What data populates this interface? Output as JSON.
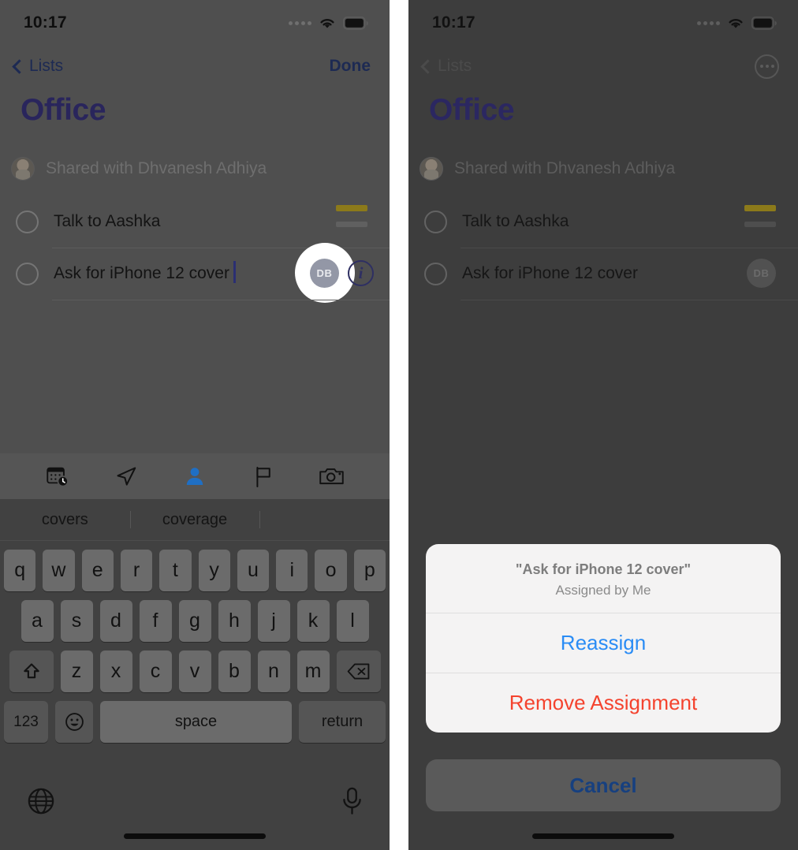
{
  "status_bar": {
    "time": "10:17",
    "signal_icon": "signal-dots-icon",
    "wifi_icon": "wifi-icon",
    "battery_icon": "battery-icon"
  },
  "left_panel": {
    "nav": {
      "back_label": "Lists",
      "back_icon": "chevron-left-icon",
      "done_label": "Done"
    },
    "list_title": "Office",
    "shared_label": "Shared with Dhvanesh Adhiya",
    "reminders": [
      {
        "text": "Talk to Aashka",
        "has_tag": true,
        "assignee": "",
        "has_info": false
      },
      {
        "text": "Ask for iPhone 12 cover",
        "has_tag": false,
        "assignee": "DB",
        "has_info": true
      }
    ],
    "info_glyph": "i",
    "quick_toolbar": [
      {
        "icon": "calendar-clock-icon",
        "active": false
      },
      {
        "icon": "location-arrow-icon",
        "active": false
      },
      {
        "icon": "person-icon",
        "active": true
      },
      {
        "icon": "flag-icon",
        "active": false
      },
      {
        "icon": "camera-icon",
        "active": false
      }
    ],
    "keyboard": {
      "suggestions": [
        "covers",
        "coverage",
        ""
      ],
      "row1": [
        "q",
        "w",
        "e",
        "r",
        "t",
        "y",
        "u",
        "i",
        "o",
        "p"
      ],
      "row2": [
        "a",
        "s",
        "d",
        "f",
        "g",
        "h",
        "j",
        "k",
        "l"
      ],
      "row3": [
        "z",
        "x",
        "c",
        "v",
        "b",
        "n",
        "m"
      ],
      "shift_icon": "shift-up-icon",
      "backspace_icon": "backspace-icon",
      "numbers_key": "123",
      "emoji_icon": "emoji-smiley-icon",
      "space_key": "space",
      "return_key": "return",
      "globe_icon": "globe-icon",
      "mic_icon": "microphone-icon"
    }
  },
  "right_panel": {
    "nav": {
      "back_label": "Lists",
      "back_icon": "chevron-left-icon",
      "more_icon": "ellipsis-circle-icon"
    },
    "list_title": "Office",
    "shared_label": "Shared with Dhvanesh Adhiya",
    "reminders": [
      {
        "text": "Talk to Aashka",
        "has_tag": true,
        "assignee": "",
        "has_info": false
      },
      {
        "text": "Ask for iPhone 12 cover",
        "has_tag": false,
        "assignee": "DB",
        "has_info": false
      }
    ],
    "action_sheet": {
      "title": "\"Ask for iPhone 12 cover\"",
      "subtitle": "Assigned by Me",
      "reassign_label": "Reassign",
      "remove_label": "Remove Assignment",
      "cancel_label": "Cancel"
    }
  },
  "colors": {
    "accent_blue": "#2a8cf5",
    "destructive_red": "#f4432e",
    "title_indigo": "#29255c",
    "nav_blue": "#1d2a53",
    "tag_yellow": "#8c7a1a",
    "dim_backdrop": "#4f4f4f"
  }
}
